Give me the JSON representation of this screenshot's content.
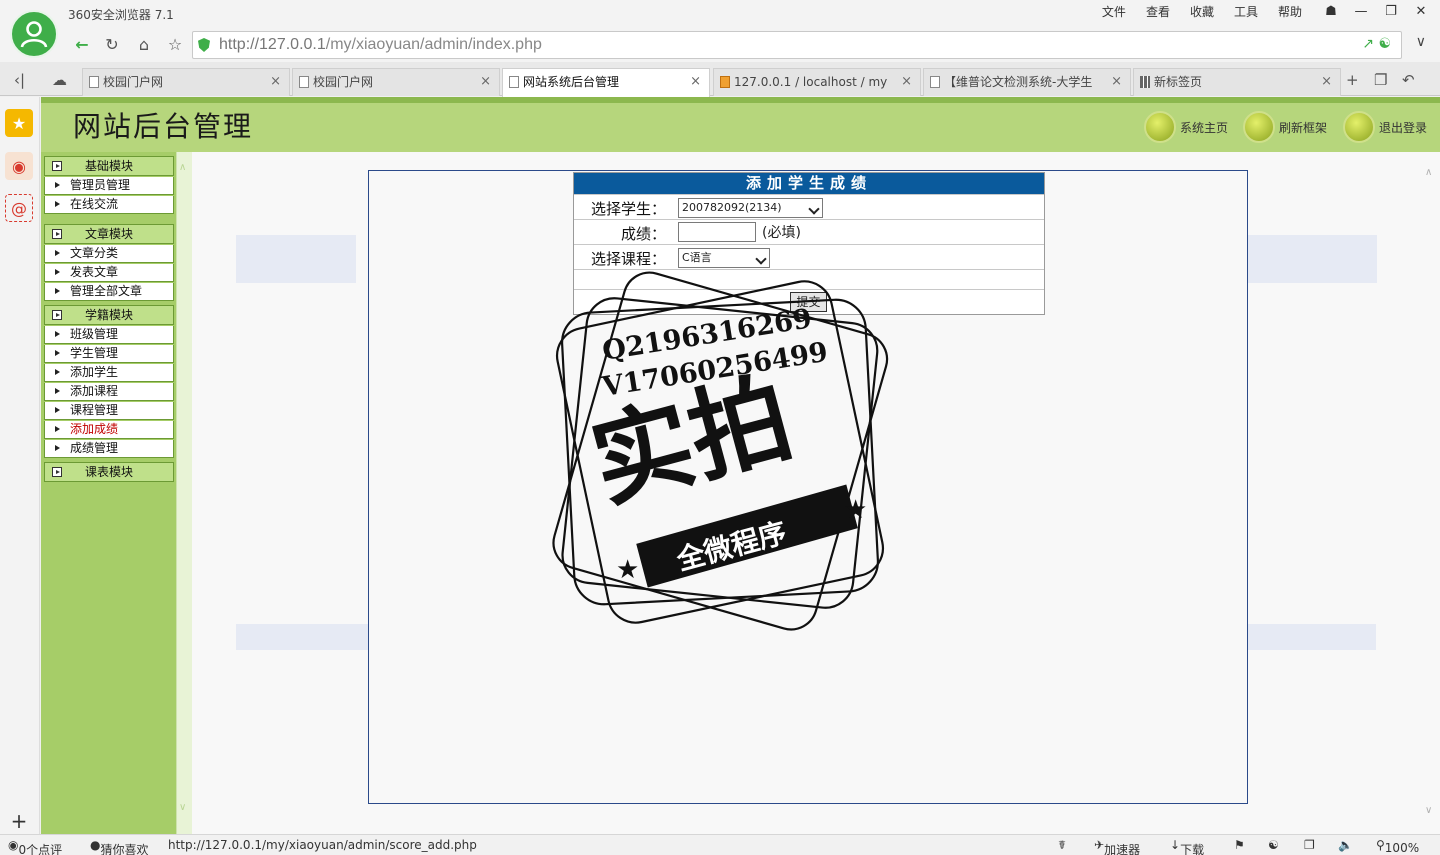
{
  "browser": {
    "app_title": "360安全浏览器 7.1",
    "menu": [
      "文件",
      "查看",
      "收藏",
      "工具",
      "帮助"
    ],
    "url_host": "http://127.0.0.1",
    "url_path": "/my/xiaoyuan/admin/index.php",
    "tabs": [
      {
        "label": "校园门户网",
        "active": false
      },
      {
        "label": "校园门户网",
        "active": false
      },
      {
        "label": "网站系统后台管理",
        "active": true
      },
      {
        "label": "127.0.0.1 / localhost / my",
        "active": false
      },
      {
        "label": "【维普论文检测系统-大学生",
        "active": false
      },
      {
        "label": "新标签页",
        "active": false
      }
    ]
  },
  "site": {
    "title": "网站后台管理",
    "top_links": [
      "系统主页",
      "刷新框架",
      "退出登录"
    ]
  },
  "nav": {
    "modules": [
      {
        "title": "基础模块",
        "items": [
          "管理员管理",
          "在线交流"
        ]
      },
      {
        "title": "文章模块",
        "items": [
          "文章分类",
          "发表文章",
          "管理全部文章"
        ]
      },
      {
        "title": "学籍模块",
        "items": [
          "班级管理",
          "学生管理",
          "添加学生",
          "添加课程",
          "课程管理",
          "添加成绩",
          "成绩管理"
        ]
      },
      {
        "title": "课表模块",
        "items": []
      }
    ],
    "active_item": "添加成绩"
  },
  "form": {
    "title": "添加学生成绩",
    "student_label": "选择学生：",
    "student_value": "200782092(2134)",
    "score_label": "成绩：",
    "score_value": "",
    "score_hint": "(必填)",
    "course_label": "选择课程：",
    "course_value": "C语言",
    "submit_label": "提交"
  },
  "watermark": {
    "line1": "Q2196316269",
    "line2": "V17060256499",
    "main": "实拍",
    "ribbon": "全微程序"
  },
  "status": {
    "reviews": "0个点评",
    "guess": "猜你喜欢",
    "link": "http://127.0.0.1/my/xiaoyuan/admin/score_add.php",
    "accelerator": "加速器",
    "download": "下载",
    "zoom": "100%"
  }
}
